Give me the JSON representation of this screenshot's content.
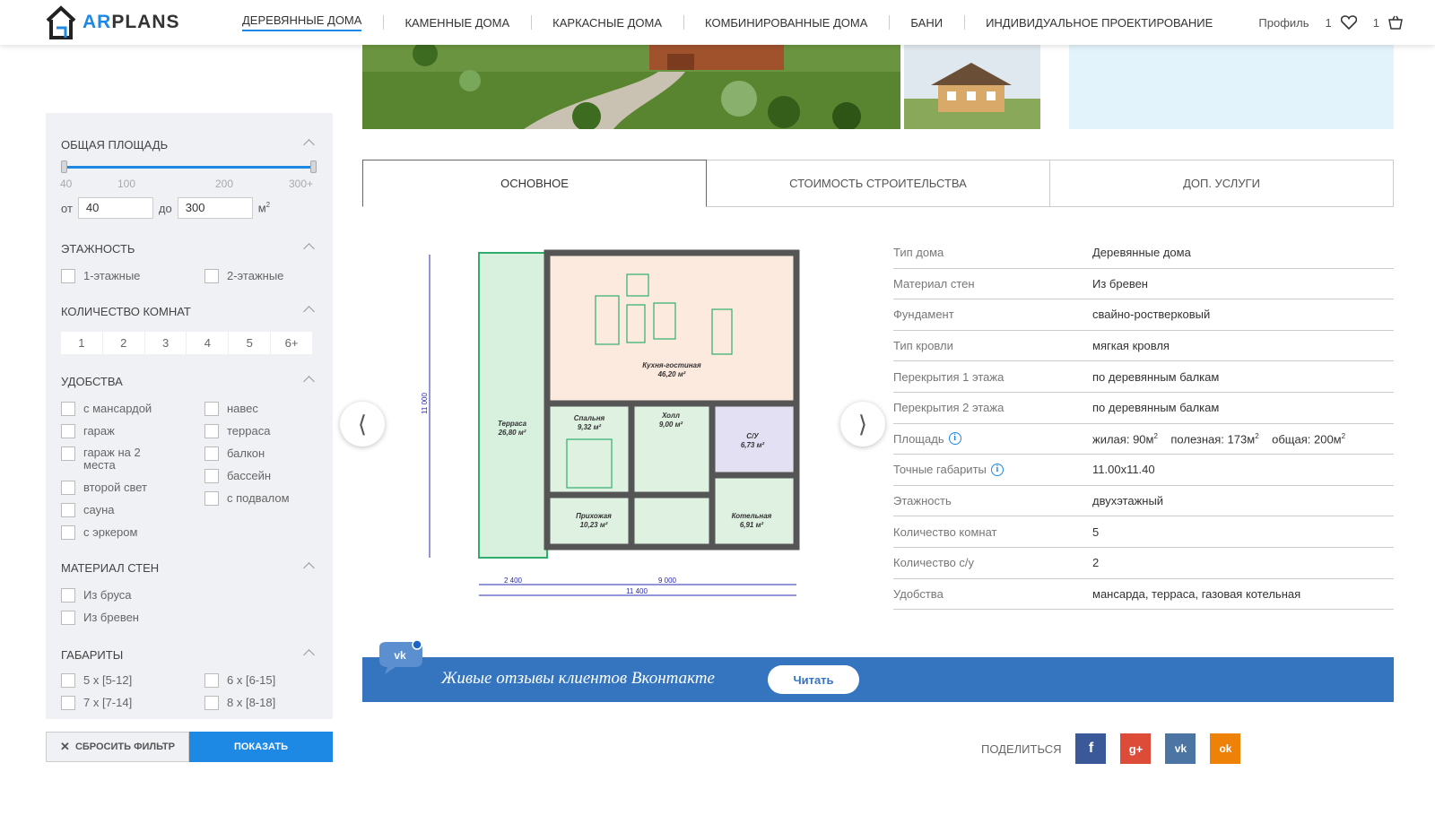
{
  "brand": {
    "logo_ar": "AR",
    "logo_plans": "PLANS"
  },
  "nav": {
    "items": [
      {
        "label": "Деревянные дома"
      },
      {
        "label": "Каменные дома"
      },
      {
        "label": "Каркасные дома"
      },
      {
        "label": "Комбинированные дома"
      },
      {
        "label": "Бани"
      },
      {
        "label": "Индивидуальное проектирование"
      }
    ],
    "active_index": 0
  },
  "header_right": {
    "profile": "Профиль",
    "favorites_count": "1",
    "cart_count": "1"
  },
  "filters": {
    "area": {
      "title": "Общая площадь",
      "ticks": [
        "40",
        "100",
        "200",
        "300+"
      ],
      "from_label": "от",
      "from_value": "40",
      "to_label": "до",
      "to_value": "300",
      "unit": "м",
      "unit_sup": "2",
      "range_min": 40,
      "range_max": 300
    },
    "floors": {
      "title": "Этажность",
      "options": [
        "1-этажные",
        "2-этажные"
      ]
    },
    "rooms": {
      "title": "Количество комнат",
      "options": [
        "1",
        "2",
        "3",
        "4",
        "5",
        "6+"
      ]
    },
    "amenities": {
      "title": "Удобства",
      "left": [
        "с мансардой",
        "гараж",
        "гараж на 2 места",
        "второй свет",
        "сауна",
        "с эркером"
      ],
      "right": [
        "навес",
        "терраса",
        "балкон",
        "бассейн",
        "с подвалом"
      ]
    },
    "walls": {
      "title": "Материал стен",
      "options": [
        "Из бруса",
        "Из бревен"
      ]
    },
    "dims": {
      "title": "Габариты",
      "left": [
        "5 х [5-12]",
        "7 х [7-14]"
      ],
      "right": [
        "6 х [6-15]",
        "8 х [8-18]"
      ]
    },
    "reset_label": "Сбросить фильтр",
    "show_label": "Показать"
  },
  "tabs": [
    {
      "label": "Основное"
    },
    {
      "label": "Стоимость строительства"
    },
    {
      "label": "Доп. услуги"
    }
  ],
  "plan": {
    "rooms": [
      {
        "name": "Кухня-гостиная",
        "area": "46,20 м²"
      },
      {
        "name": "Терраса",
        "area": "26,80 м²"
      },
      {
        "name": "Спальня",
        "area": "9,32 м²"
      },
      {
        "name": "Холл",
        "area": "9,00 м²"
      },
      {
        "name": "С/У",
        "area": "6,73 м²"
      },
      {
        "name": "Прихожая",
        "area": "10,23 м²"
      },
      {
        "name": "Котельная",
        "area": "6,91 м²"
      }
    ],
    "dims": {
      "d1": "2 400",
      "d2": "9 000",
      "d3": "11 400",
      "dv": "11 000"
    }
  },
  "specs": [
    {
      "key": "Тип дома",
      "value": "Деревянные дома"
    },
    {
      "key": "Материал стен",
      "value": "Из бревен"
    },
    {
      "key": "Фундамент",
      "value": "свайно-ростверковый"
    },
    {
      "key": "Тип кровли",
      "value": "мягкая кровля"
    },
    {
      "key": "Перекрытия 1 этажа",
      "value": "по деревянным балкам"
    },
    {
      "key": "Перекрытия 2 этажа",
      "value": "по деревянным балкам"
    },
    {
      "key": "Площадь",
      "value": ""
    },
    {
      "key": "Точные габариты",
      "value": "11.00х11.40"
    },
    {
      "key": "Этажность",
      "value": "двухэтажный"
    },
    {
      "key": "Количество комнат",
      "value": "5"
    },
    {
      "key": "Количество с/у",
      "value": "2"
    },
    {
      "key": "Удобства",
      "value": "мансарда, терраса, газовая котельная"
    }
  ],
  "area_values": {
    "living_label": "жилая:",
    "living": "90м",
    "useful_label": "полезная:",
    "useful": "173м",
    "total_label": "общая:",
    "total": "200м",
    "sup": "2"
  },
  "vk": {
    "badge": "vk",
    "title": "Живые отзывы клиентов Вконтакте",
    "read_label": "Читать"
  },
  "share": {
    "label": "Поделиться",
    "networks": [
      "f",
      "g+",
      "vk",
      "ok"
    ]
  },
  "colors": {
    "accent": "#1e88e5",
    "vk": "#3575c0",
    "facebook": "#3b5998",
    "googleplus": "#dd4b39",
    "vk_social": "#4c75a3",
    "ok": "#ee8208"
  }
}
